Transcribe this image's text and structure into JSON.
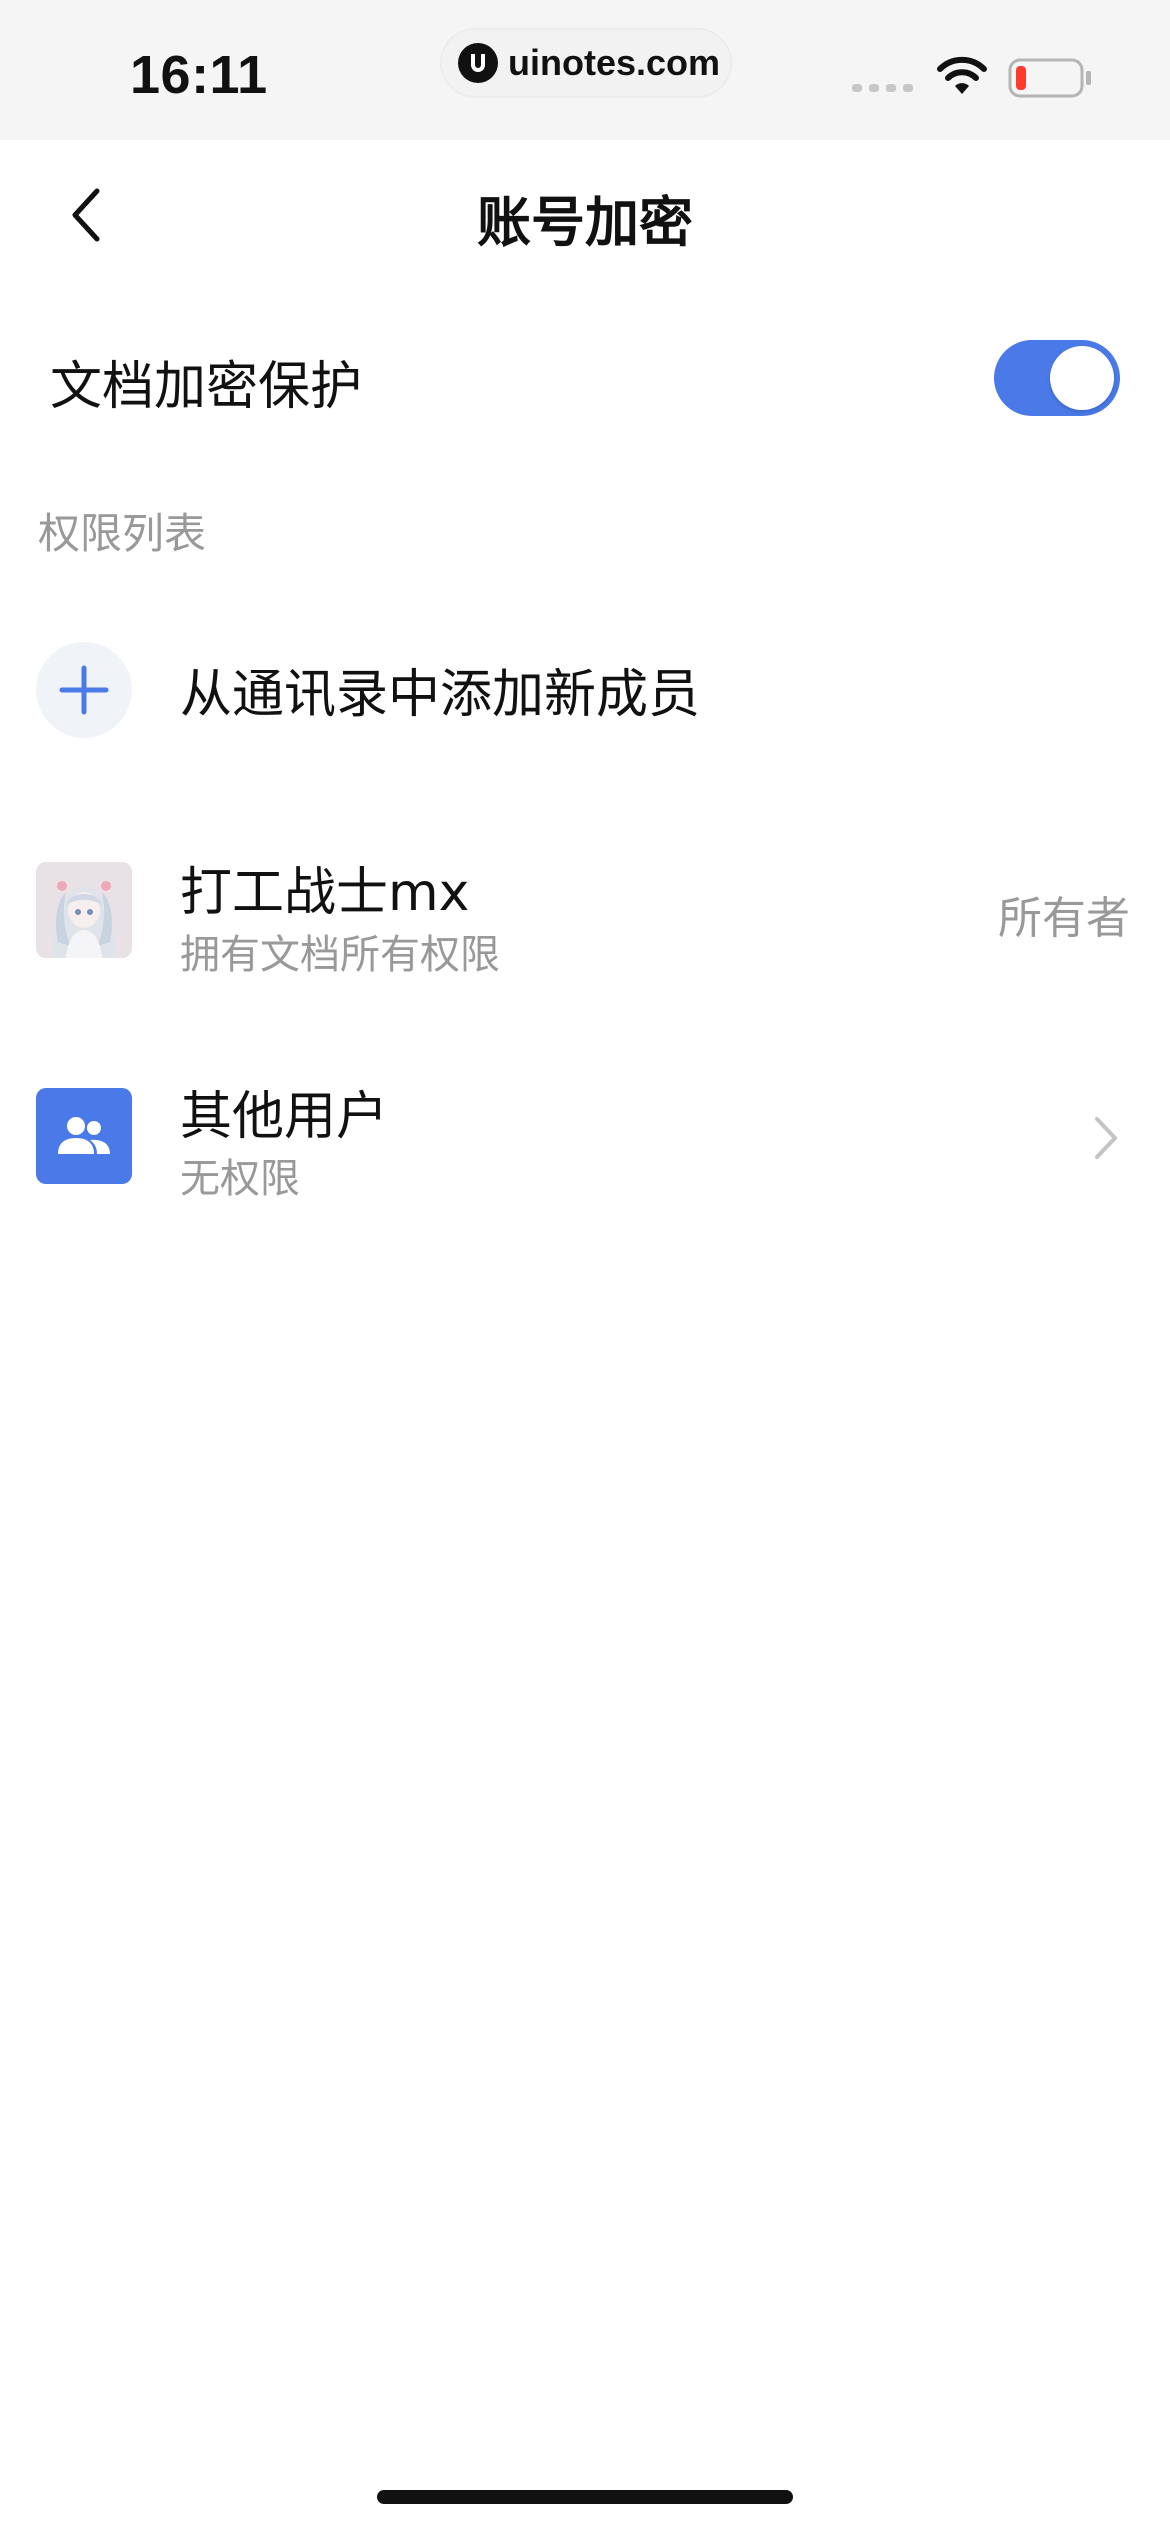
{
  "status_bar": {
    "time": "16:11",
    "url": "uinotes.com",
    "battery_color": "#ff3b30"
  },
  "nav": {
    "title": "账号加密",
    "back_icon": "chevron-left-icon"
  },
  "protection": {
    "label": "文档加密保护",
    "enabled": true,
    "accent": "#4a7ae8"
  },
  "permissions": {
    "section_title": "权限列表",
    "add_member_label": "从通讯录中添加新成员",
    "members": [
      {
        "name": "打工战士mx",
        "subtitle": "拥有文档所有权限",
        "badge": "所有者",
        "icon": "avatar"
      },
      {
        "name": "其他用户",
        "subtitle": "无权限",
        "icon": "users-icon"
      }
    ]
  }
}
